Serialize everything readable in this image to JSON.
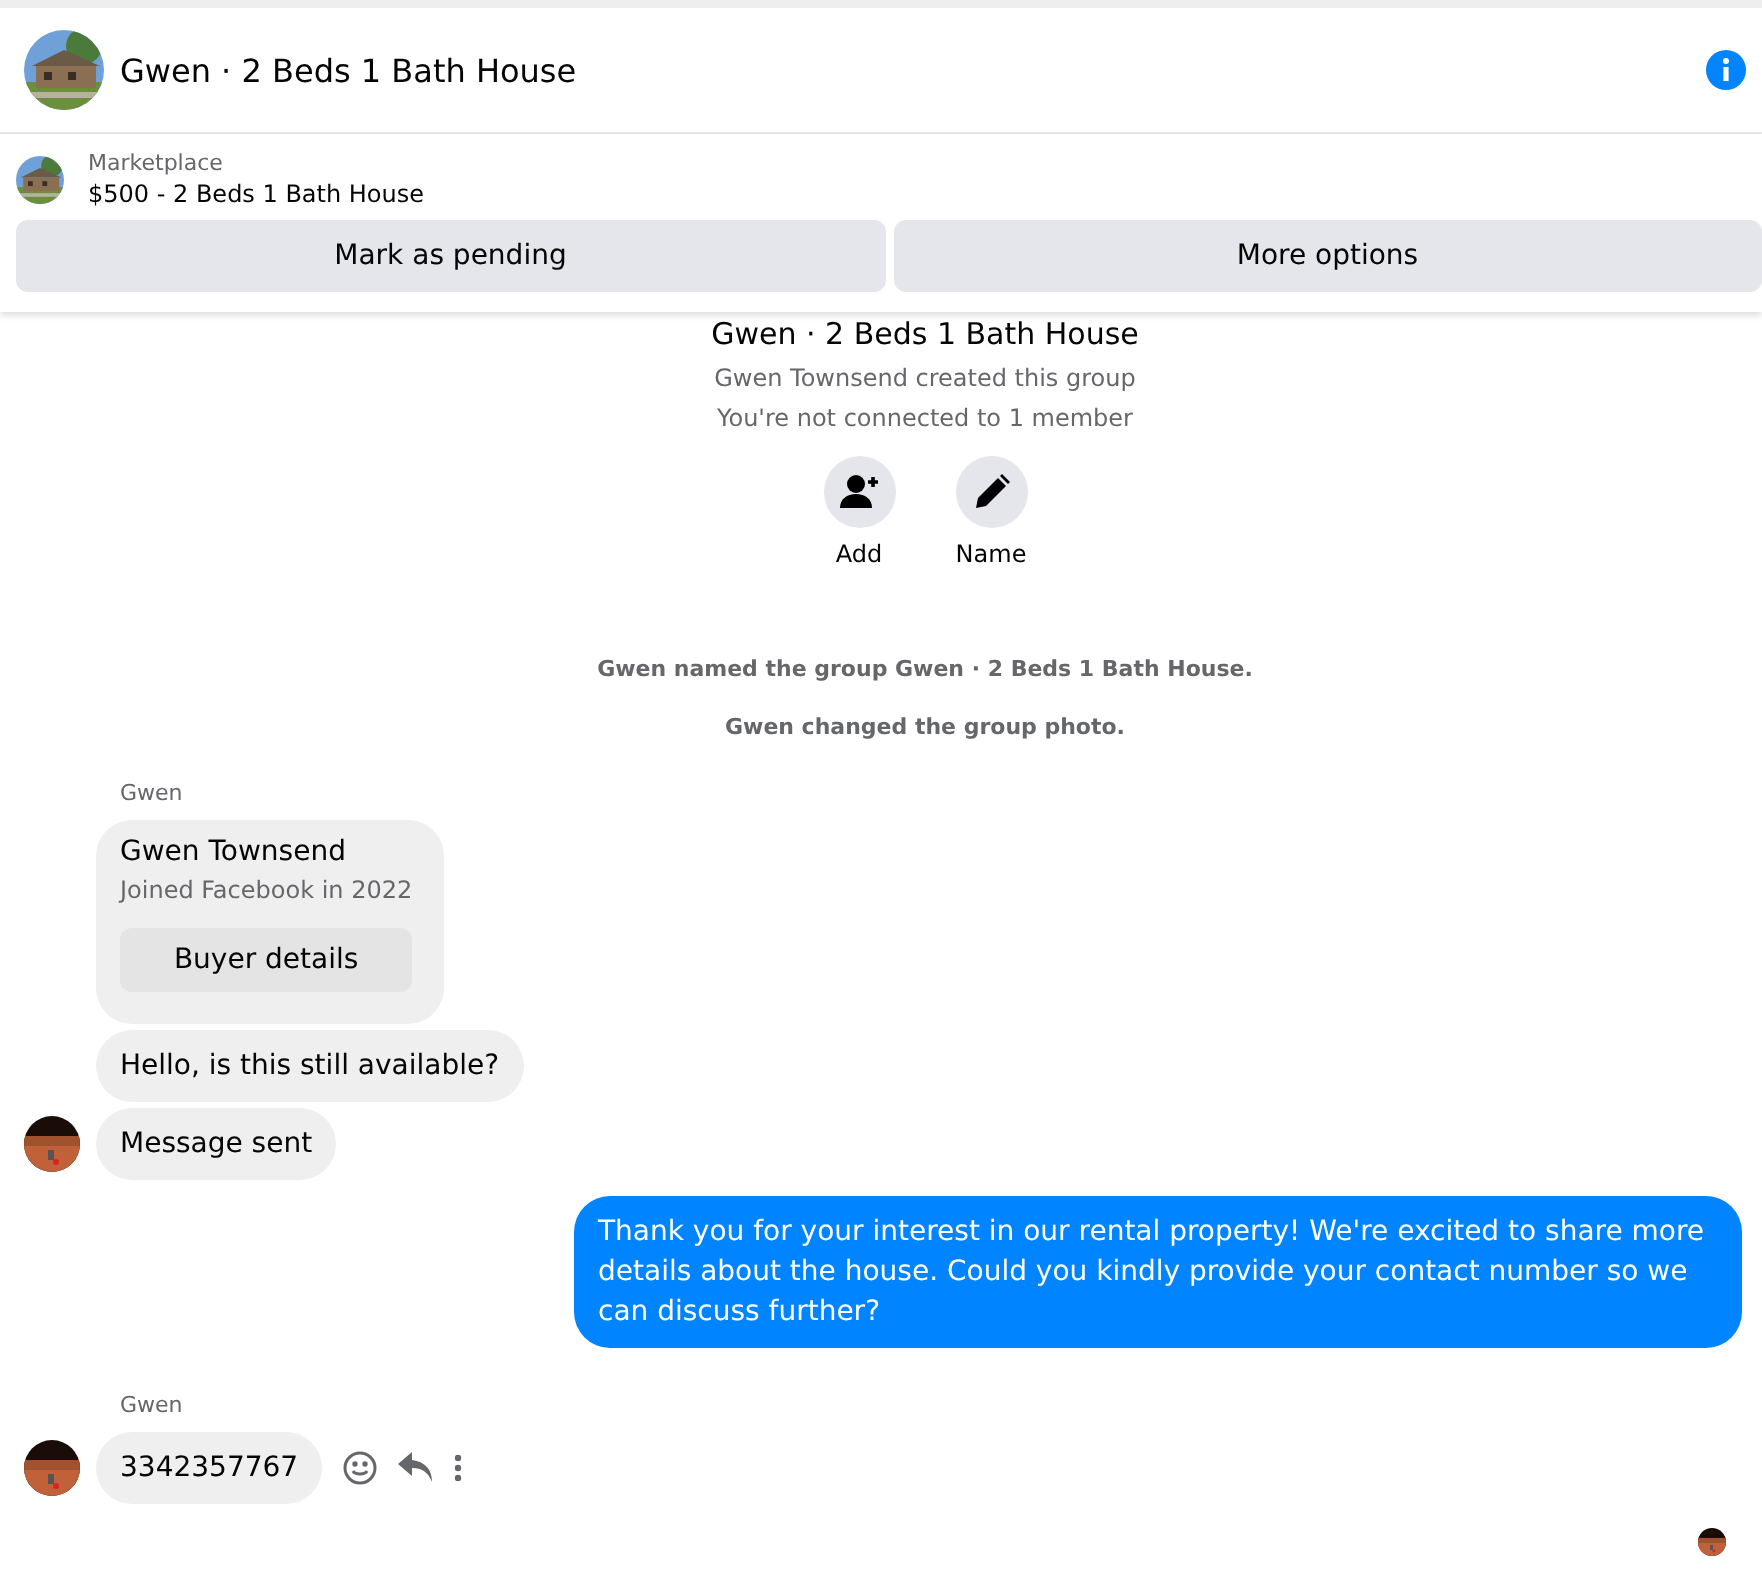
{
  "header": {
    "title": "Gwen · 2 Beds 1 Bath House"
  },
  "listing": {
    "label": "Marketplace",
    "title": "$500 - 2 Beds 1 Bath House",
    "buttons": [
      "Mark as pending",
      "More options"
    ]
  },
  "intro": {
    "title": "Gwen · 2 Beds 1 Bath House",
    "lines": [
      "Gwen Townsend created this group",
      "You're not connected to 1 member"
    ],
    "actions": [
      {
        "kind": "add",
        "label": "Add"
      },
      {
        "kind": "name",
        "label": "Name"
      }
    ]
  },
  "events": [
    "Gwen named the group Gwen · 2 Beds 1 Bath House.",
    "Gwen changed the group photo."
  ],
  "groups": [
    {
      "outgoing": false,
      "sender": "Gwen",
      "messages": [
        {
          "kind": "card",
          "name": "Gwen Townsend",
          "sub": "Joined Facebook in 2022",
          "button": "Buyer details"
        },
        {
          "kind": "text",
          "text": "Hello, is this still available?"
        },
        {
          "kind": "text",
          "text": "Message sent"
        }
      ]
    },
    {
      "outgoing": true,
      "messages": [
        {
          "kind": "text",
          "text": "Thank you for your interest in our rental property! We're excited to share more details about the house. Could you kindly provide your contact number so we can discuss further?"
        }
      ]
    },
    {
      "outgoing": false,
      "sender": "Gwen",
      "messages": [
        {
          "kind": "text",
          "text": "3342357767",
          "actions": true
        }
      ]
    }
  ]
}
